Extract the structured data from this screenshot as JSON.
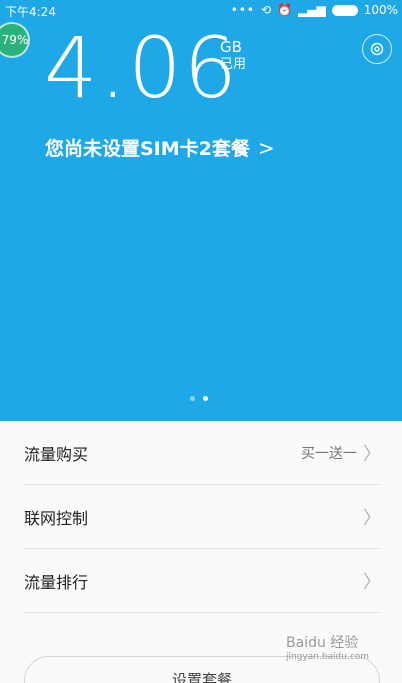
{
  "status_bar": {
    "time": "下午4:24",
    "battery": "100%"
  },
  "floating_bubble": {
    "percent": "79%"
  },
  "usage": {
    "value": "4.06",
    "unit": "GB",
    "unit_caption": "已用"
  },
  "sim_notice": {
    "text": "您尚未设置SIM卡2套餐"
  },
  "menu": {
    "items": [
      {
        "label": "流量购买",
        "value": "买一送一"
      },
      {
        "label": "联网控制",
        "value": ""
      },
      {
        "label": "流量排行",
        "value": ""
      }
    ]
  },
  "bottom_button": {
    "label": "设置套餐"
  },
  "watermark": {
    "text": "Baidu 经验",
    "url": "jingyan.baidu.com"
  },
  "colors": {
    "hero_bg": "#1fa8e8",
    "bubble": "#28b46e"
  },
  "icons": {
    "settings": "gear-icon",
    "chevron": "chevron-right-icon"
  }
}
